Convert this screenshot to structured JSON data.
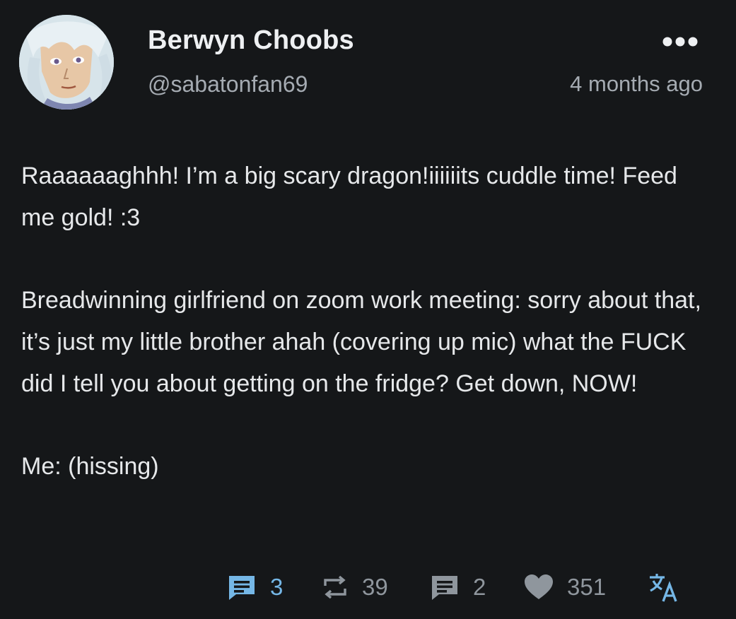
{
  "post": {
    "author": {
      "display_name": "Berwyn Choobs",
      "handle": "@sabatonfan69",
      "avatar_icon": "anime-avatar-white-hair"
    },
    "timestamp": "4 months ago",
    "more_icon": "more-options-icon",
    "body": {
      "paragraph_1": "Raaaaaaghhh! I’m a big scary dragon!iiiiiits cuddle time! Feed me gold! :3",
      "paragraph_2": "Breadwinning girlfriend on zoom work meeting: sorry about that, it’s just my little brother ahah (covering up mic) what the FUCK did I tell you about getting on the fridge? Get down, NOW!",
      "paragraph_3": "Me: (hissing)"
    },
    "actions": {
      "replies": {
        "icon": "reply-icon",
        "count": "3",
        "color": "#75b7e6"
      },
      "reposts": {
        "icon": "repost-icon",
        "count": "39",
        "color": "#8f969d"
      },
      "quotes": {
        "icon": "quote-icon",
        "count": "2",
        "color": "#8f969d"
      },
      "likes": {
        "icon": "heart-icon",
        "count": "351",
        "color": "#8f969d"
      },
      "translate": {
        "icon": "translate-icon",
        "color": "#75b7e6"
      }
    }
  },
  "colors": {
    "background": "#151719",
    "text_primary": "#eef0f2",
    "text_secondary": "#a5abb2",
    "accent": "#75b7e6"
  }
}
